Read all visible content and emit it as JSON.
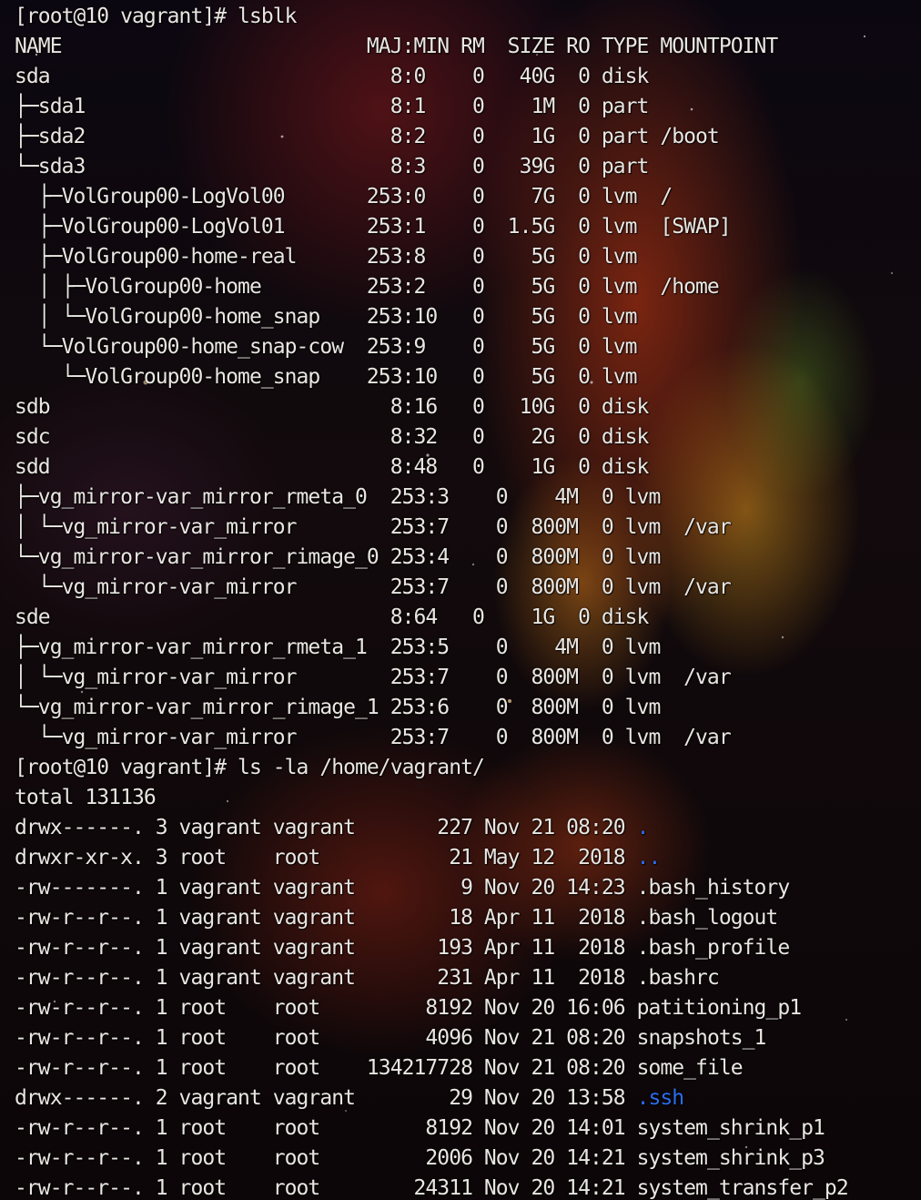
{
  "terminal": {
    "lines": [
      {
        "text": "[root@10 vagrant]# lsblk",
        "type": "prompt"
      },
      {
        "text": "NAME                          MAJ:MIN RM  SIZE RO TYPE MOUNTPOINT",
        "type": "header"
      },
      {
        "text": "sda                             8:0    0   40G  0 disk ",
        "type": "output"
      },
      {
        "text": "├─sda1                          8:1    0    1M  0 part ",
        "type": "output"
      },
      {
        "text": "├─sda2                          8:2    0    1G  0 part /boot",
        "type": "output"
      },
      {
        "text": "└─sda3                          8:3    0   39G  0 part ",
        "type": "output"
      },
      {
        "text": "  ├─VolGroup00-LogVol00       253:0    0    7G  0 lvm  /",
        "type": "output"
      },
      {
        "text": "  ├─VolGroup00-LogVol01       253:1    0  1.5G  0 lvm  [SWAP]",
        "type": "output"
      },
      {
        "text": "  ├─VolGroup00-home-real      253:8    0    5G  0 lvm  ",
        "type": "output"
      },
      {
        "text": "  │ ├─VolGroup00-home         253:2    0    5G  0 lvm  /home",
        "type": "output"
      },
      {
        "text": "  │ └─VolGroup00-home_snap    253:10   0    5G  0 lvm  ",
        "type": "output"
      },
      {
        "text": "  └─VolGroup00-home_snap-cow  253:9    0    5G  0 lvm  ",
        "type": "output"
      },
      {
        "text": "    └─VolGroup00-home_snap    253:10   0    5G  0 lvm  ",
        "type": "output"
      },
      {
        "text": "sdb                             8:16   0   10G  0 disk ",
        "type": "output"
      },
      {
        "text": "sdc                             8:32   0    2G  0 disk ",
        "type": "output"
      },
      {
        "text": "sdd                             8:48   0    1G  0 disk ",
        "type": "output"
      },
      {
        "text": "├─vg_mirror-var_mirror_rmeta_0  253:3    0    4M  0 lvm  ",
        "type": "output"
      },
      {
        "text": "│ └─vg_mirror-var_mirror        253:7    0  800M  0 lvm  /var",
        "type": "output"
      },
      {
        "text": "└─vg_mirror-var_mirror_rimage_0 253:4    0  800M  0 lvm  ",
        "type": "output"
      },
      {
        "text": "  └─vg_mirror-var_mirror        253:7    0  800M  0 lvm  /var",
        "type": "output"
      },
      {
        "text": "sde                             8:64   0    1G  0 disk ",
        "type": "output"
      },
      {
        "text": "├─vg_mirror-var_mirror_rmeta_1  253:5    0    4M  0 lvm  ",
        "type": "output"
      },
      {
        "text": "│ └─vg_mirror-var_mirror        253:7    0  800M  0 lvm  /var",
        "type": "output"
      },
      {
        "text": "└─vg_mirror-var_mirror_rimage_1 253:6    0  800M  0 lvm  ",
        "type": "output"
      },
      {
        "text": "  └─vg_mirror-var_mirror        253:7    0  800M  0 lvm  /var",
        "type": "output"
      },
      {
        "text": "[root@10 vagrant]# ls -la /home/vagrant/",
        "type": "prompt"
      },
      {
        "text": "total 131136",
        "type": "output"
      }
    ],
    "listing": [
      {
        "meta": "drwx------. 3 vagrant vagrant       227 Nov 21 08:20 ",
        "name": ".",
        "is_dir": true
      },
      {
        "meta": "drwxr-xr-x. 3 root    root           21 May 12  2018 ",
        "name": "..",
        "is_dir": true
      },
      {
        "meta": "-rw-------. 1 vagrant vagrant         9 Nov 20 14:23 ",
        "name": ".bash_history",
        "is_dir": false
      },
      {
        "meta": "-rw-r--r--. 1 vagrant vagrant        18 Apr 11  2018 ",
        "name": ".bash_logout",
        "is_dir": false
      },
      {
        "meta": "-rw-r--r--. 1 vagrant vagrant       193 Apr 11  2018 ",
        "name": ".bash_profile",
        "is_dir": false
      },
      {
        "meta": "-rw-r--r--. 1 vagrant vagrant       231 Apr 11  2018 ",
        "name": ".bashrc",
        "is_dir": false
      },
      {
        "meta": "-rw-r--r--. 1 root    root         8192 Nov 20 16:06 ",
        "name": "patitioning_p1",
        "is_dir": false
      },
      {
        "meta": "-rw-r--r--. 1 root    root         4096 Nov 21 08:20 ",
        "name": "snapshots_1",
        "is_dir": false
      },
      {
        "meta": "-rw-r--r--. 1 root    root    134217728 Nov 21 08:20 ",
        "name": "some_file",
        "is_dir": false
      },
      {
        "meta": "drwx------. 2 vagrant vagrant        29 Nov 20 13:58 ",
        "name": ".ssh",
        "is_dir": true
      },
      {
        "meta": "-rw-r--r--. 1 root    root         8192 Nov 20 14:01 ",
        "name": "system_shrink_p1",
        "is_dir": false
      },
      {
        "meta": "-rw-r--r--. 1 root    root         2006 Nov 20 14:21 ",
        "name": "system_shrink_p3",
        "is_dir": false
      },
      {
        "meta": "-rw-r--r--. 1 root    root        24311 Nov 20 14:21 ",
        "name": "system_transfer_p2",
        "is_dir": false
      }
    ],
    "colors": {
      "foreground": "#e9e6e2",
      "directory": "#2a6df0"
    }
  }
}
